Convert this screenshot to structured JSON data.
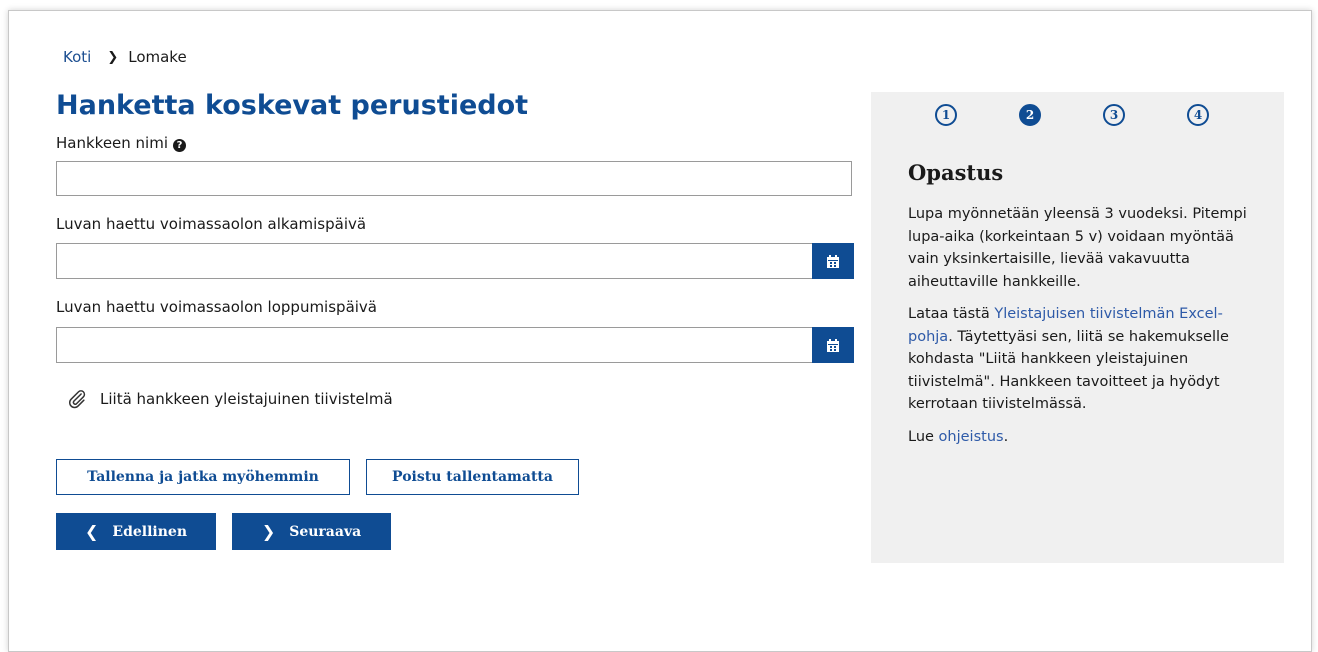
{
  "breadcrumb": {
    "home": "Koti",
    "current": "Lomake"
  },
  "form": {
    "title": "Hanketta koskevat perustiedot",
    "project_name_label": "Hankkeen nimi",
    "project_name_value": "",
    "start_date_label": "Luvan haettu voimassaolon alkamispäivä",
    "start_date_value": "",
    "end_date_label": "Luvan haettu voimassaolon loppumispäivä",
    "end_date_value": "",
    "attach_label": "Liitä hankkeen yleistajuinen tiivistelmä"
  },
  "buttons": {
    "save_continue": "Tallenna ja jatka myöhemmin",
    "exit_without_saving": "Poistu tallentamatta",
    "previous": "Edellinen",
    "next": "Seuraava"
  },
  "steps": {
    "items": [
      "1",
      "2",
      "3",
      "4"
    ],
    "current": 2
  },
  "guide": {
    "title": "Opastus",
    "paragraph1": "Lupa myönnetään yleensä 3 vuodeksi. Pitempi lupa-aika (korkeintaan 5 v) voidaan myöntää vain yksinkertaisille, lievää vakavuutta aiheuttaville hankkeille.",
    "paragraph2_prefix": "Lataa tästä ",
    "paragraph2_link": "Yleistajuisen tiivistelmän Excel-pohja",
    "paragraph2_suffix": ". Täytettyäsi sen, liitä se hakemukselle kohdasta \"Liitä hankkeen yleistajuinen tiivistelmä\". Hankkeen tavoitteet ja hyödyt kerrotaan tiivistelmässä.",
    "paragraph3_prefix": "Lue ",
    "paragraph3_link": "ohjeistus",
    "paragraph3_suffix": "."
  },
  "colors": {
    "primary": "#0f4c93",
    "link": "#2e5aa8",
    "panel_bg": "#f0f0f0"
  },
  "icons": {
    "help": "question-circle-icon",
    "calendar": "calendar-icon",
    "attach": "paperclip-icon",
    "previous": "chevron-left-icon",
    "next": "chevron-right-icon"
  }
}
